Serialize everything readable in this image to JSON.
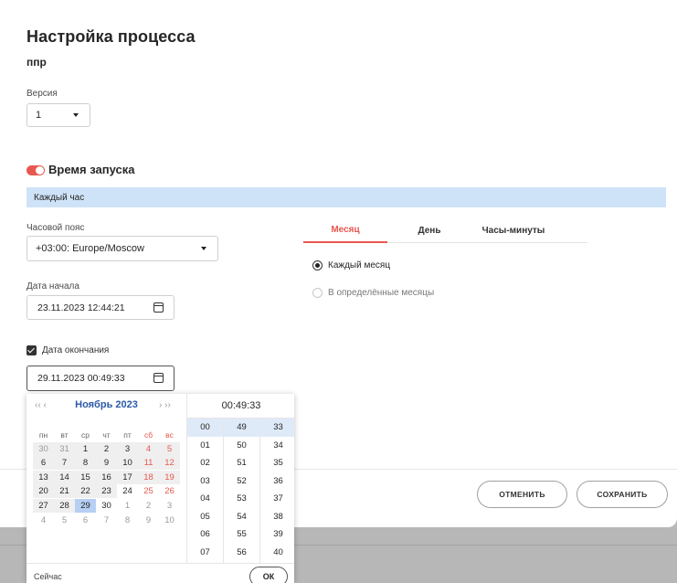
{
  "dialog": {
    "title": "Настройка процесса",
    "subtitle": "ппр",
    "version_label": "Версия",
    "version_value": "1"
  },
  "schedule": {
    "toggle_on": true,
    "title": "Время запуска",
    "banner": "Каждый час",
    "timezone_label": "Часовой пояс",
    "timezone_value": "+03:00: Europe/Moscow",
    "start_label": "Дата начала",
    "start_value": "23.11.2023 12:44:21",
    "end_checkbox_label": "Дата окончания",
    "end_value": "29.11.2023 00:49:33"
  },
  "tabs": [
    "Месяц",
    "День",
    "Часы-минуты"
  ],
  "month_options": [
    "Каждый месяц",
    "В определённые месяцы"
  ],
  "buttons": {
    "cancel": "ОТМЕНИТЬ",
    "save": "СОХРАНИТЬ"
  },
  "picker": {
    "nav_prev": "‹‹ ‹",
    "nav_next": "› ››",
    "month_title": "Ноябрь 2023",
    "weekdays": [
      "пн",
      "вт",
      "ср",
      "чт",
      "пт",
      "сб",
      "вс"
    ],
    "days": [
      [
        "30",
        "31",
        "1",
        "2",
        "3",
        "4",
        "5"
      ],
      [
        "6",
        "7",
        "8",
        "9",
        "10",
        "11",
        "12"
      ],
      [
        "13",
        "14",
        "15",
        "16",
        "17",
        "18",
        "19"
      ],
      [
        "20",
        "21",
        "22",
        "23",
        "24",
        "25",
        "26"
      ],
      [
        "27",
        "28",
        "29",
        "30",
        "1",
        "2",
        "3"
      ],
      [
        "4",
        "5",
        "6",
        "7",
        "8",
        "9",
        "10"
      ]
    ],
    "time_value": "00:49:33",
    "hours": [
      "00",
      "01",
      "02",
      "03",
      "04",
      "05",
      "06",
      "07"
    ],
    "minutes": [
      "49",
      "50",
      "51",
      "52",
      "53",
      "54",
      "55",
      "56"
    ],
    "seconds": [
      "33",
      "34",
      "35",
      "36",
      "37",
      "38",
      "39",
      "40"
    ],
    "now_label": "Сейчас",
    "ok_label": "ОК"
  },
  "colors": {
    "accent": "#e8584f",
    "selection": "#b6cff3",
    "banner": "#cfe3f8",
    "month_title": "#2c5aa8"
  }
}
